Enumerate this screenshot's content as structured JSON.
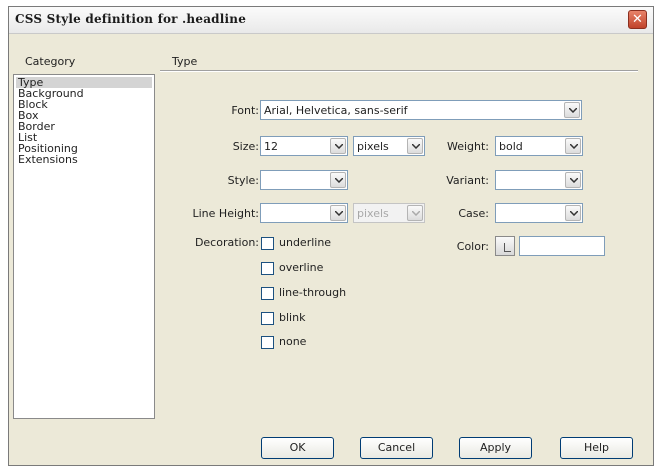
{
  "dialog": {
    "title": "CSS Style definition for .headline",
    "close_icon": "close-icon"
  },
  "category": {
    "header": "Category",
    "items": [
      "Type",
      "Background",
      "Block",
      "Box",
      "Border",
      "List",
      "Positioning",
      "Extensions"
    ],
    "selected": "Type"
  },
  "panel": {
    "header": "Type"
  },
  "form": {
    "font_label": "Font:",
    "font_value": "Arial, Helvetica, sans-serif",
    "size_label": "Size:",
    "size_value": "12",
    "size_unit": "pixels",
    "weight_label": "Weight:",
    "weight_value": "bold",
    "style_label": "Style:",
    "style_value": "",
    "variant_label": "Variant:",
    "variant_value": "",
    "line_height_label": "Line Height:",
    "line_height_value": "",
    "line_height_unit": "pixels",
    "case_label": "Case:",
    "case_value": "",
    "color_label": "Color:",
    "color_value": "",
    "decoration_label": "Decoration:",
    "decorations": [
      {
        "label": "underline",
        "checked": false
      },
      {
        "label": "overline",
        "checked": false
      },
      {
        "label": "line-through",
        "checked": false
      },
      {
        "label": "blink",
        "checked": false
      },
      {
        "label": "none",
        "checked": false
      }
    ]
  },
  "buttons": {
    "ok": "OK",
    "cancel": "Cancel",
    "apply": "Apply",
    "help": "Help"
  },
  "colors": {
    "dialog_bg": "#ece9d8",
    "field_border": "#7f9db9",
    "close_button": "#c0432a",
    "selected_category": "#d4d4d4"
  }
}
